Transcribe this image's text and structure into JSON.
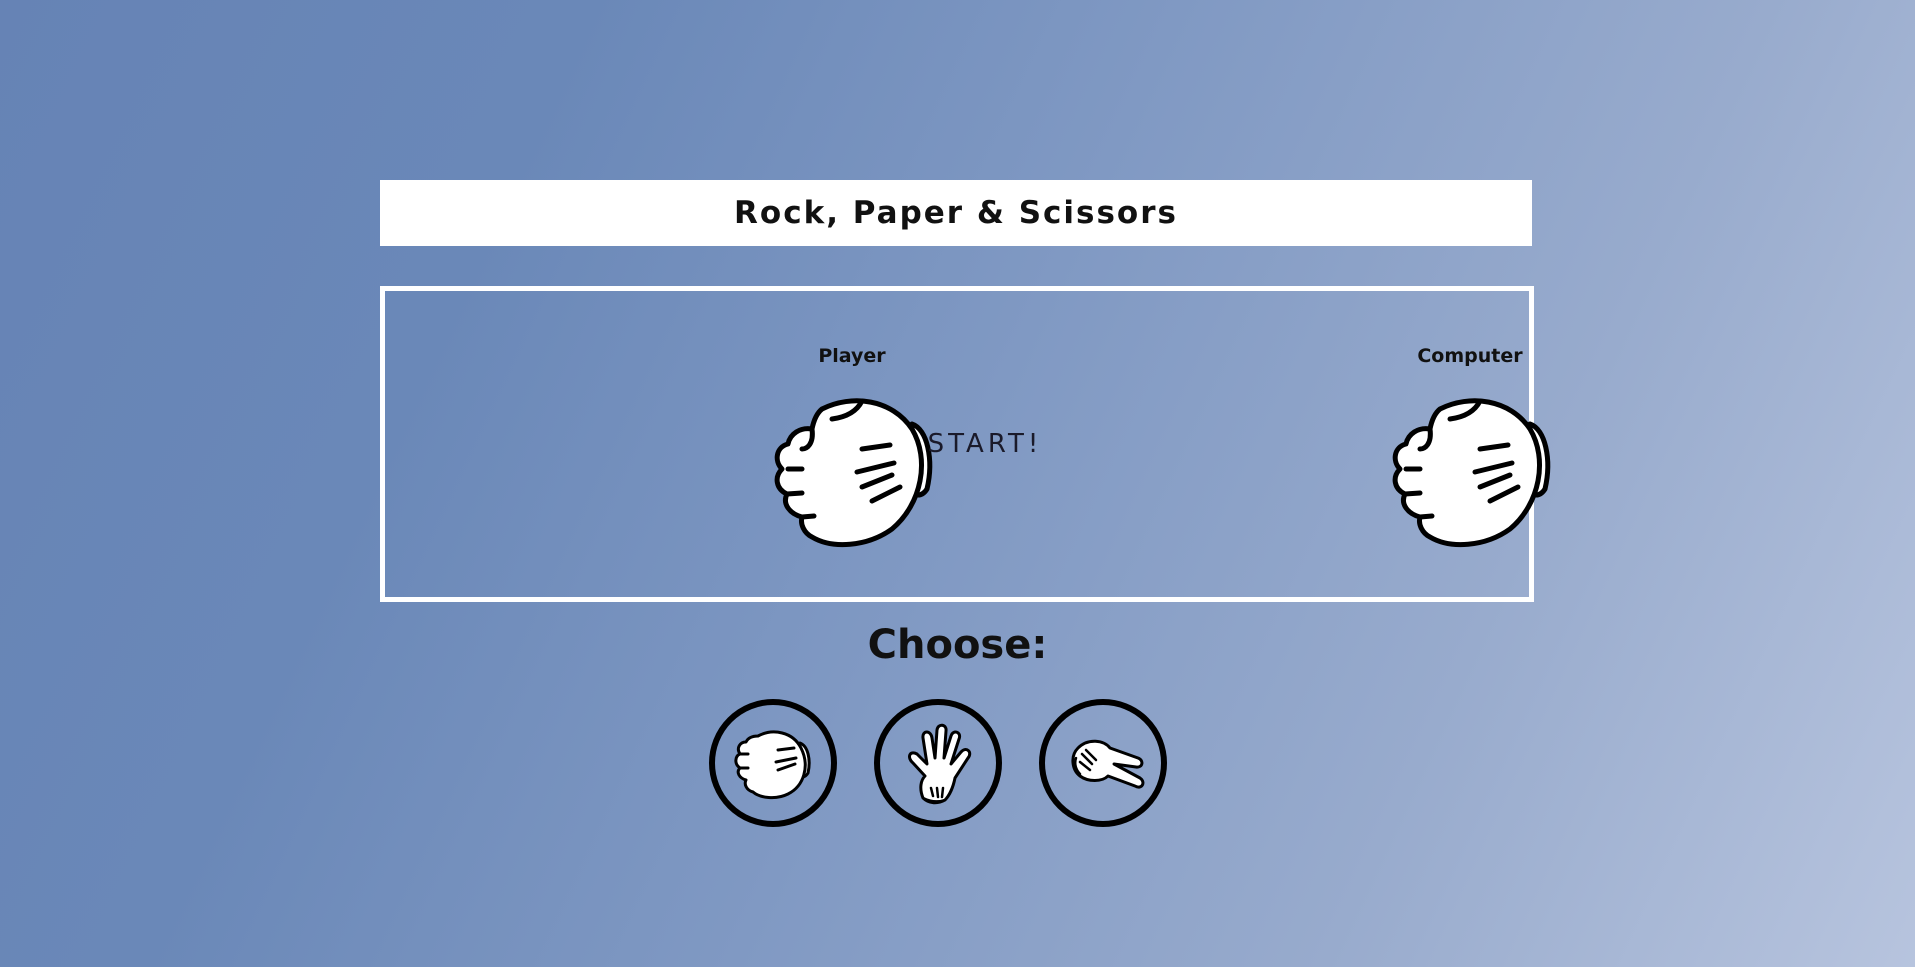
{
  "header": {
    "title": "Rock, Paper & Scissors"
  },
  "arena": {
    "player_label": "Player",
    "computer_label": "Computer",
    "status": "START!",
    "player_hand_icon": "rock-hand-icon",
    "computer_hand_icon": "rock-hand-icon"
  },
  "choices": {
    "label": "Choose:",
    "options": [
      {
        "icon": "rock-hand-icon"
      },
      {
        "icon": "paper-hand-icon"
      },
      {
        "icon": "scissors-hand-icon"
      }
    ]
  },
  "colors": {
    "background_start": "#6683b5",
    "background_end": "#b7c4de",
    "panel": "#ffffff",
    "text": "#111111"
  }
}
